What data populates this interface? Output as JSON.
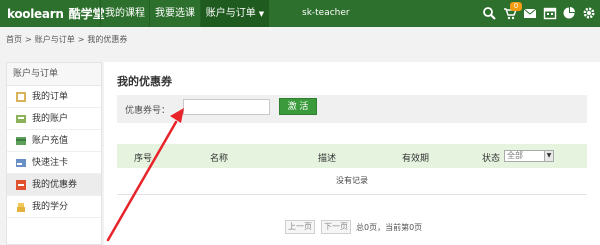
{
  "header": {
    "logo_word": "koolearn",
    "logo_brand": "酷学堂",
    "nav": [
      "我的课程",
      "我要选课",
      "账户与订单"
    ],
    "user": "sk-teacher",
    "cart_count": "0",
    "icons": [
      "search-icon",
      "cart-icon",
      "mail-icon",
      "calendar-icon",
      "chart-icon",
      "settings-icon"
    ]
  },
  "breadcrumb": [
    "首页",
    "账户与订单",
    "我的优惠券"
  ],
  "sidebar": {
    "title": "账户与订单",
    "items": [
      "我的订单",
      "我的账户",
      "账户充值",
      "快速注卡",
      "我的优惠券",
      "我的学分"
    ]
  },
  "main": {
    "title": "我的优惠券",
    "form_label": "优惠券号：",
    "code_value": "",
    "activate": "激 活",
    "columns": [
      "序号",
      "名称",
      "描述",
      "有效期",
      "状态"
    ],
    "status_selected": "全部",
    "empty_text": "没有记录",
    "pager": {
      "prev": "上一页",
      "next": "下一页",
      "info": "总0页，当前第0页"
    }
  },
  "colors": {
    "topbar": "#2d6f2d",
    "accent_green": "#3b9a3b",
    "table_head": "#e6f3df",
    "annotation_red": "#e8232a"
  }
}
